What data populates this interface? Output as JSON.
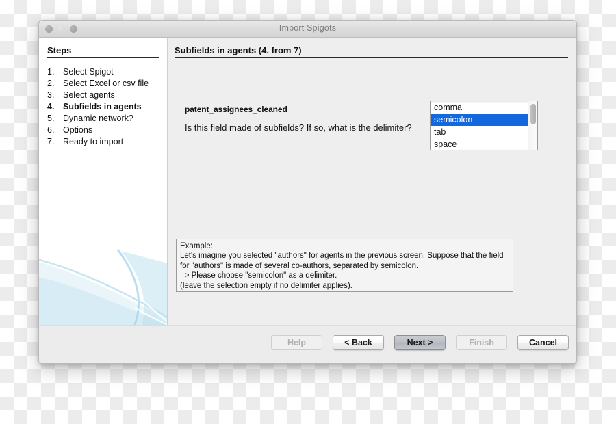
{
  "window": {
    "title": "Import Spigots",
    "controls": [
      "close-button",
      "minimize-button",
      "zoom-button"
    ]
  },
  "sidebar": {
    "title": "Steps",
    "items": [
      {
        "num": "1.",
        "label": "Select Spigot",
        "current": false
      },
      {
        "num": "2.",
        "label": "Select Excel or csv file",
        "current": false
      },
      {
        "num": "3.",
        "label": "Select agents",
        "current": false
      },
      {
        "num": "4.",
        "label": "Subfields in agents",
        "current": true
      },
      {
        "num": "5.",
        "label": "Dynamic network?",
        "current": false
      },
      {
        "num": "6.",
        "label": "Options",
        "current": false
      },
      {
        "num": "7.",
        "label": "Ready to import",
        "current": false
      }
    ]
  },
  "content": {
    "header": "Subfields in agents (4. from 7)",
    "field_name": "patent_assignees_cleaned",
    "question": "Is this field made of subfields? If so, what is the delimiter?",
    "delimiter_list": {
      "options": [
        "comma",
        "semicolon",
        "tab",
        "space"
      ],
      "selected": "semicolon",
      "selected_index": 1,
      "selection_color": "#1468dd"
    },
    "example": {
      "lines": [
        "Example:",
        "Let's imagine you selected \"authors\" for agents in the previous screen. Suppose that the field",
        "for \"authors\" is made of several co-authors, separated by semicolon.",
        "=> Please choose \"semicolon\" as a delimiter.",
        "(leave the selection empty if no delimiter applies)."
      ]
    }
  },
  "footer": {
    "buttons": [
      {
        "label": "Help",
        "state": "disabled"
      },
      {
        "label": "< Back",
        "state": "enabled"
      },
      {
        "label": "Next >",
        "state": "default"
      },
      {
        "label": "Finish",
        "state": "disabled"
      },
      {
        "label": "Cancel",
        "state": "enabled"
      }
    ]
  }
}
